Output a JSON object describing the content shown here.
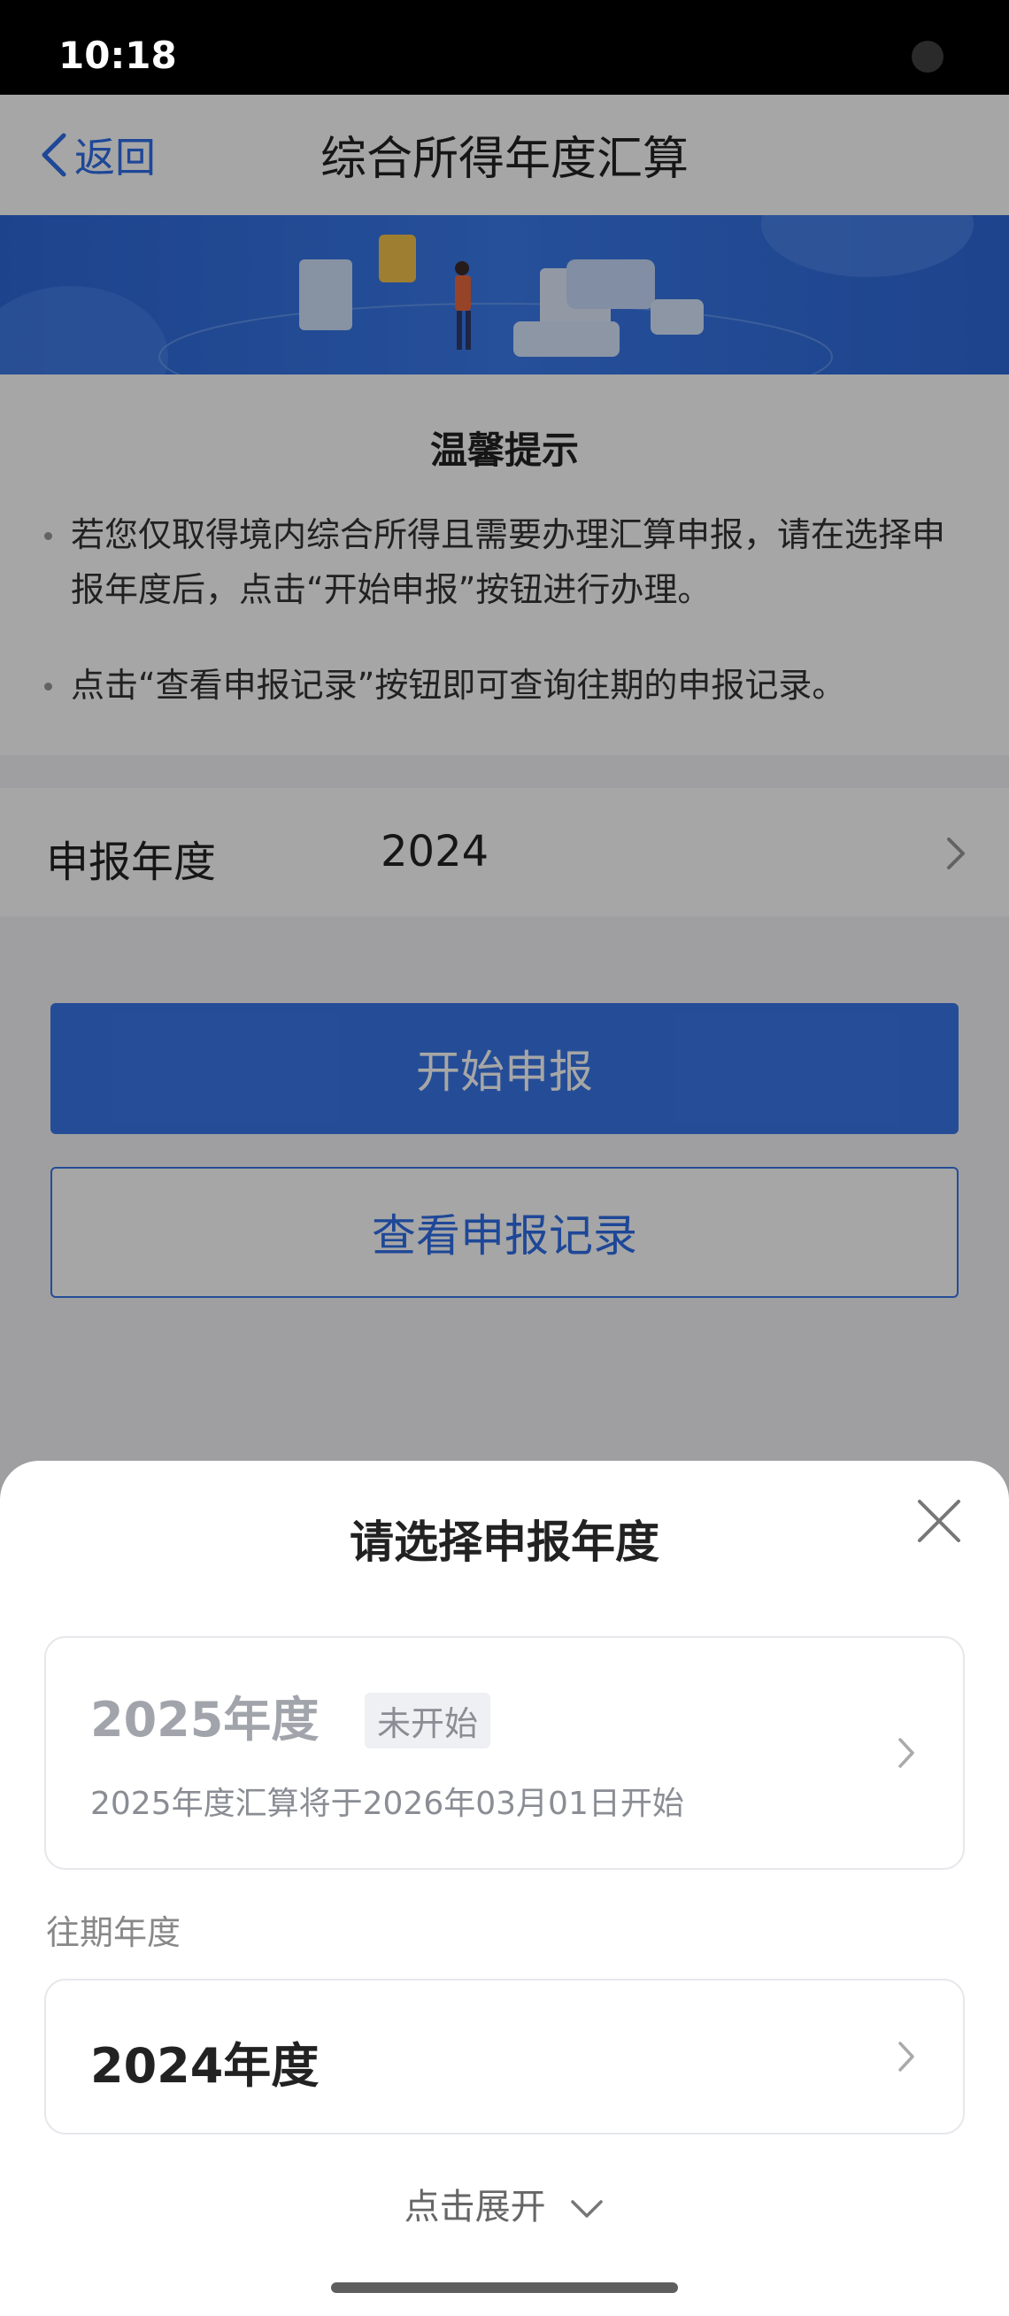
{
  "status_bar": {
    "time": "10:18"
  },
  "nav": {
    "back_label": "返回",
    "title": "综合所得年度汇算"
  },
  "tips": {
    "title": "温馨提示",
    "items": [
      "若您仅取得境内综合所得且需要办理汇算申报，请在选择申报年度后，点击“开始申报”按钮进行办理。",
      "点击“查看申报记录”按钮即可查询往期的申报记录。"
    ]
  },
  "year_row": {
    "label": "申报年度",
    "value": "2024"
  },
  "buttons": {
    "start": "开始申报",
    "records": "查看申报记录"
  },
  "sheet": {
    "title": "请选择申报年度",
    "current": {
      "title": "2025年度",
      "badge": "未开始",
      "desc": "2025年度汇算将于2026年03月01日开始"
    },
    "past_label": "往期年度",
    "past": [
      {
        "title": "2024年度"
      }
    ],
    "expand_label": "点击展开"
  },
  "colors": {
    "accent": "#3a77e8",
    "banner": "#2d68d8"
  }
}
